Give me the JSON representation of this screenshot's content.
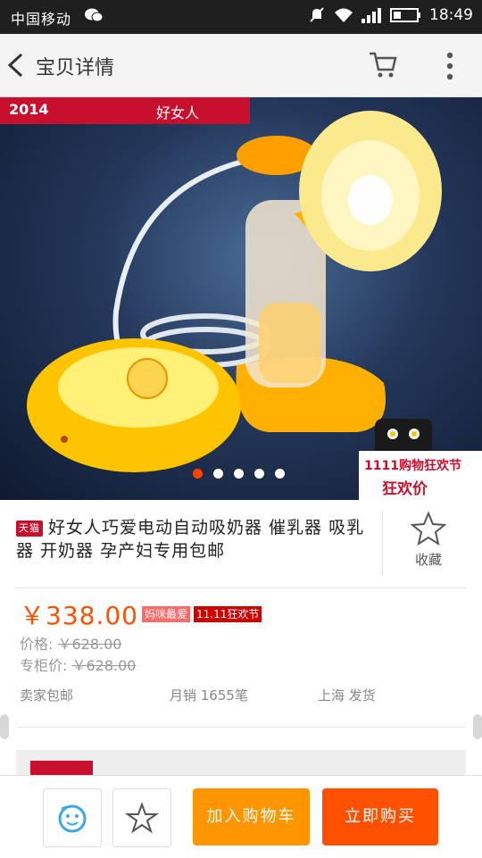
{
  "status_bar": {
    "carrier": "中国移动",
    "time": "18:49"
  },
  "nav": {
    "title": "宝贝详情"
  },
  "hero": {
    "brand_logo": "好女人",
    "brand_tag": "2014",
    "badge_line1": "1111购物狂欢节",
    "badge_line2": "狂欢价",
    "carousel_active": 1,
    "carousel_count": 5
  },
  "product": {
    "store_badge": "天猫",
    "title": "好女人巧爱电动自动吸奶器 催乳器 吸乳器 开奶器 孕产妇专用包邮",
    "fav_label": "收藏"
  },
  "pricing": {
    "price": "￥338.00",
    "tag1": "妈咪最爱",
    "tag2": "11.11狂欢节",
    "orig_label": "价格:",
    "orig_value": "￥628.00",
    "counter_label": "专柜价:",
    "counter_value": "￥628.00"
  },
  "meta": {
    "shipping": "卖家包邮",
    "sales": "月销 1655笔",
    "origin": "上海 发货"
  },
  "bottom": {
    "add_cart": "加入购物车",
    "buy_now": "立即购买"
  },
  "colors": {
    "accent": "#ff5000",
    "cart_button": "#ff9500",
    "tmall_red": "#c8102e"
  }
}
